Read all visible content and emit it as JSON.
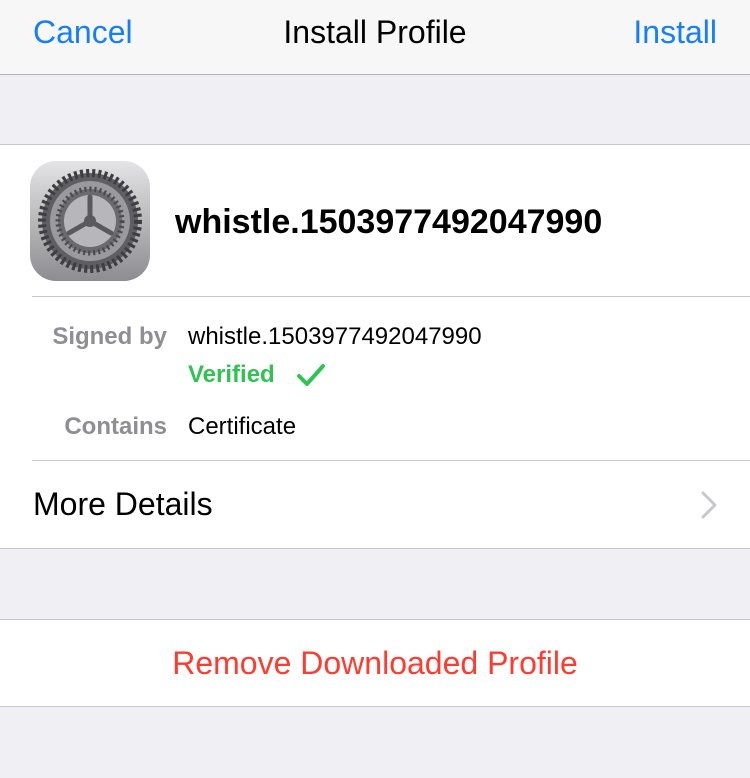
{
  "navbar": {
    "cancel_label": "Cancel",
    "title": "Install Profile",
    "install_label": "Install"
  },
  "profile": {
    "icon": "settings-gear-icon",
    "name": "whistle.1503977492047990",
    "signed_by_label": "Signed by",
    "signed_by_value": "whistle.1503977492047990",
    "verified_label": "Verified",
    "verified_icon": "checkmark-icon",
    "contains_label": "Contains",
    "contains_value": "Certificate"
  },
  "more_details": {
    "label": "More Details",
    "icon": "chevron-right-icon"
  },
  "remove": {
    "label": "Remove Downloaded Profile"
  },
  "colors": {
    "accent": "#147efb",
    "verified": "#2fc452",
    "destructive": "#ff3b30",
    "background": "#efeff4"
  }
}
